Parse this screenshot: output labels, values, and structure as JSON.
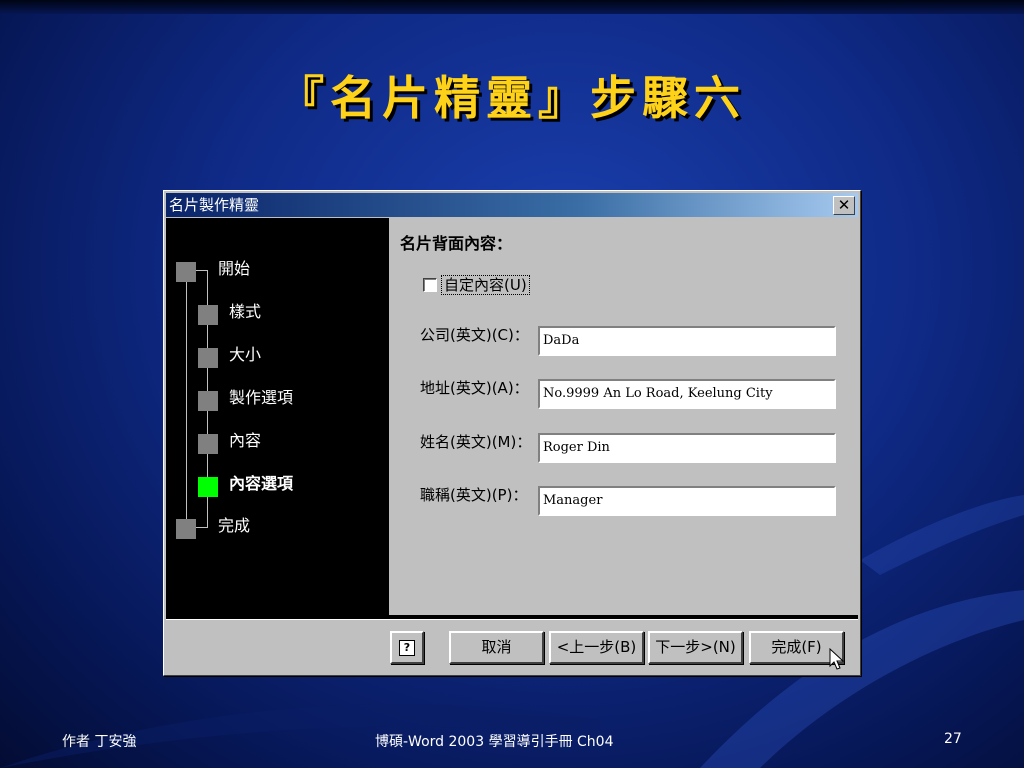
{
  "slide": {
    "title": "『名片精靈』步驟六",
    "footer_left": "作者  丁安強",
    "footer_center": "博碩-Word 2003 學習導引手冊 Ch04",
    "footer_right": "27"
  },
  "dialog": {
    "title": "名片製作精靈",
    "close_glyph": "✕",
    "steps": [
      {
        "label": "開始",
        "state": "endpoint"
      },
      {
        "label": "樣式",
        "state": "normal"
      },
      {
        "label": "大小",
        "state": "normal"
      },
      {
        "label": "製作選項",
        "state": "normal"
      },
      {
        "label": "內容",
        "state": "normal"
      },
      {
        "label": "內容選項",
        "state": "active"
      },
      {
        "label": "完成",
        "state": "endpoint"
      }
    ],
    "section_title": "名片背面內容：",
    "custom_checkbox": {
      "label": "自定內容(U)",
      "checked": false
    },
    "fields": [
      {
        "label": "公司(英文)(C)：",
        "value": "DaDa"
      },
      {
        "label": "地址(英文)(A)：",
        "value": "No.9999 An Lo Road, Keelung City"
      },
      {
        "label": "姓名(英文)(M)：",
        "value": "Roger Din"
      },
      {
        "label": "職稱(英文)(P)：",
        "value": "Manager"
      }
    ],
    "buttons": {
      "help": "?",
      "cancel": "取消",
      "back": "<上一步(B)",
      "next": "下一步>(N)",
      "finish": "完成(F)"
    }
  },
  "colors": {
    "title_text": "#ffd21a",
    "active_step": "#00ff00",
    "titlebar_start": "#0a246a"
  }
}
